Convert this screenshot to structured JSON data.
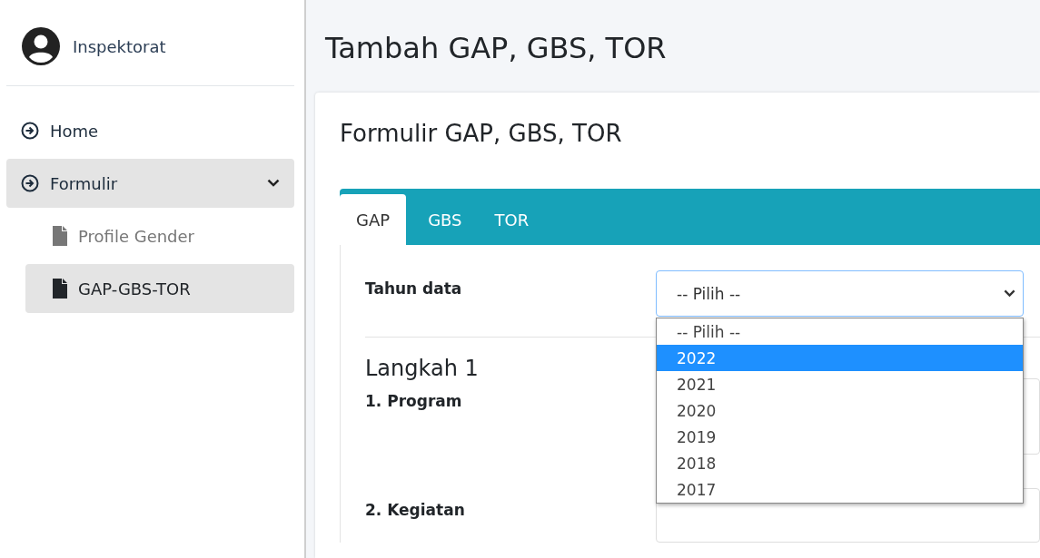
{
  "sidebar": {
    "user": {
      "name": "Inspektorat"
    },
    "items": [
      {
        "label": "Home",
        "selected": false
      },
      {
        "label": "Formulir",
        "selected": true,
        "expanded": true,
        "children": [
          {
            "label": "Profile Gender",
            "selected": false
          },
          {
            "label": "GAP-GBS-TOR",
            "selected": true
          }
        ]
      }
    ]
  },
  "page": {
    "title": "Tambah GAP, GBS, TOR"
  },
  "card": {
    "title": "Formulir GAP, GBS, TOR",
    "tabs": [
      {
        "label": "GAP",
        "selected": true
      },
      {
        "label": "GBS",
        "selected": false
      },
      {
        "label": "TOR",
        "selected": false
      }
    ],
    "year_field": {
      "label": "Tahun data",
      "value": "-- Pilih --",
      "expanded": true,
      "options": [
        {
          "label": "-- Pilih --",
          "highlighted": false
        },
        {
          "label": "2022",
          "highlighted": true
        },
        {
          "label": "2021",
          "highlighted": false
        },
        {
          "label": "2020",
          "highlighted": false
        },
        {
          "label": "2019",
          "highlighted": false
        },
        {
          "label": "2018",
          "highlighted": false
        },
        {
          "label": "2017",
          "highlighted": false
        }
      ]
    },
    "section_title": "Langkah 1",
    "fields": [
      {
        "label": "1. Program"
      },
      {
        "label": "2. Kegiatan"
      }
    ]
  }
}
